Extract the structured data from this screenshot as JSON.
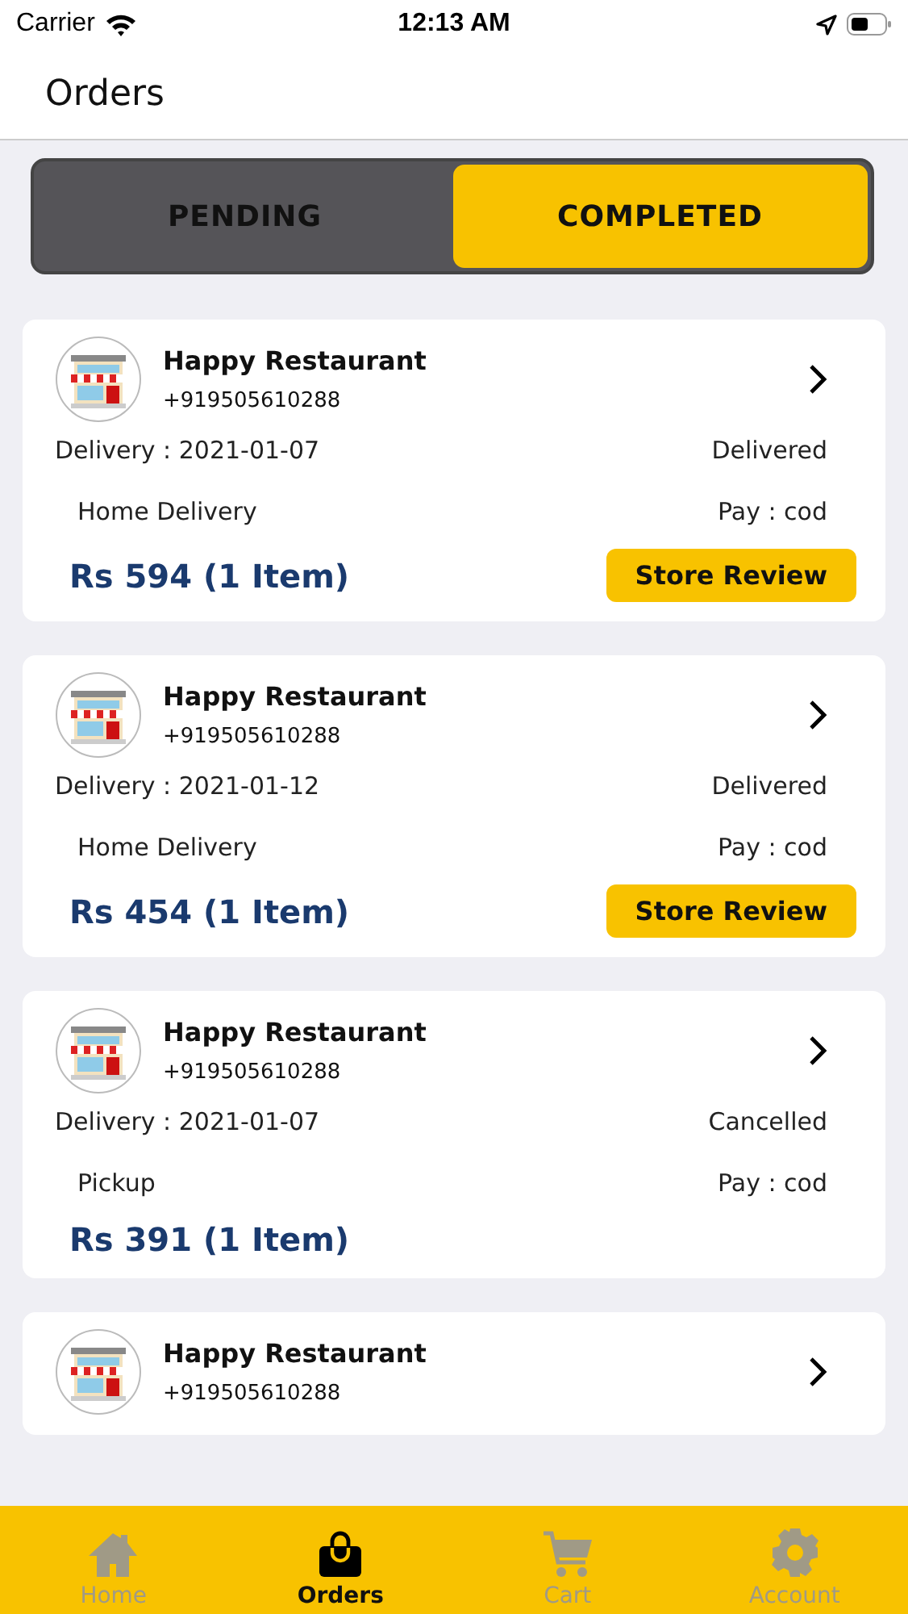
{
  "status_bar": {
    "carrier": "Carrier",
    "time": "12:13 AM"
  },
  "header": {
    "title": "Orders"
  },
  "tabs": [
    {
      "label": "PENDING",
      "selected": false
    },
    {
      "label": "COMPLETED",
      "selected": true
    }
  ],
  "orders": [
    {
      "store": "Happy Restaurant",
      "phone": "+919505610288",
      "date": "Delivery : 2021-01-07",
      "status": "Delivered",
      "method": "Home Delivery",
      "payment": "Pay : cod",
      "total": "Rs 594 (1 Item)",
      "review_button": "Store Review"
    },
    {
      "store": "Happy Restaurant",
      "phone": "+919505610288",
      "date": "Delivery : 2021-01-12",
      "status": "Delivered",
      "method": "Home Delivery",
      "payment": "Pay : cod",
      "total": "Rs 454 (1 Item)",
      "review_button": "Store Review"
    },
    {
      "store": "Happy Restaurant",
      "phone": "+919505610288",
      "date": "Delivery : 2021-01-07",
      "status": "Cancelled",
      "method": "Pickup",
      "payment": "Pay : cod",
      "total": "Rs 391 (1 Item)"
    },
    {
      "store": "Happy Restaurant",
      "phone": "+919505610288"
    }
  ],
  "tab_bar": [
    {
      "label": "Home",
      "kind": "home",
      "selected": false
    },
    {
      "label": "Orders",
      "kind": "orders",
      "selected": true
    },
    {
      "label": "Cart",
      "kind": "cart",
      "selected": false
    },
    {
      "label": "Account",
      "kind": "account",
      "selected": false
    }
  ]
}
